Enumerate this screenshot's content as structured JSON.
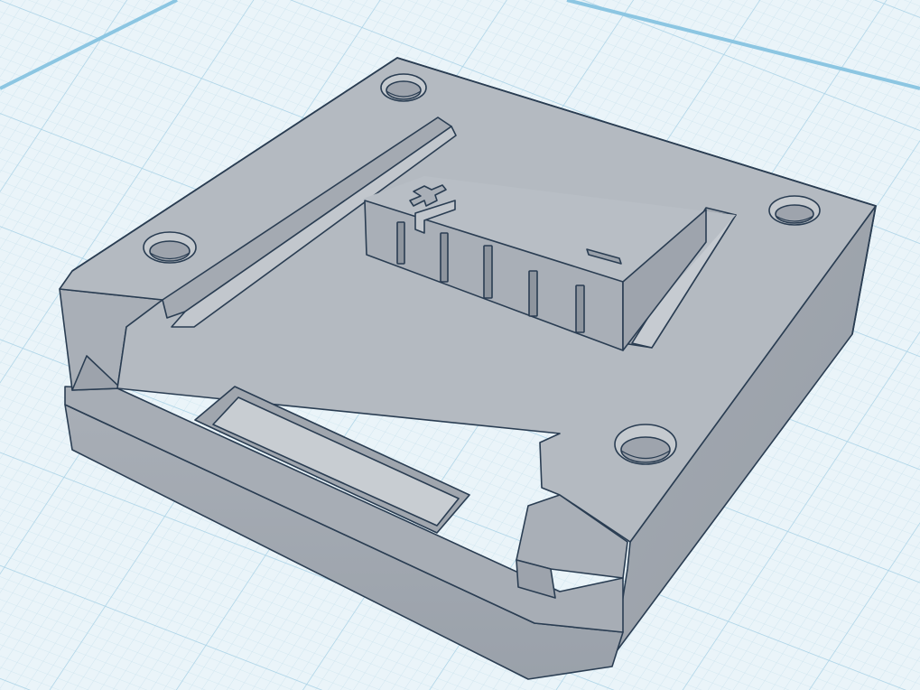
{
  "scene": {
    "workplane": {
      "background_color": "#eaf4f9",
      "minor_grid_color": "#cbe3ee",
      "major_grid_color": "#a9d2e6",
      "edge_color": "#8cc6e2"
    },
    "model": {
      "top_color": "#b4bac1",
      "side_light_color": "#a6acb4",
      "side_dark_color": "#989fa8",
      "edge_color": "#2a3d52",
      "polarity_plus": "+",
      "polarity_minus": "−"
    }
  }
}
